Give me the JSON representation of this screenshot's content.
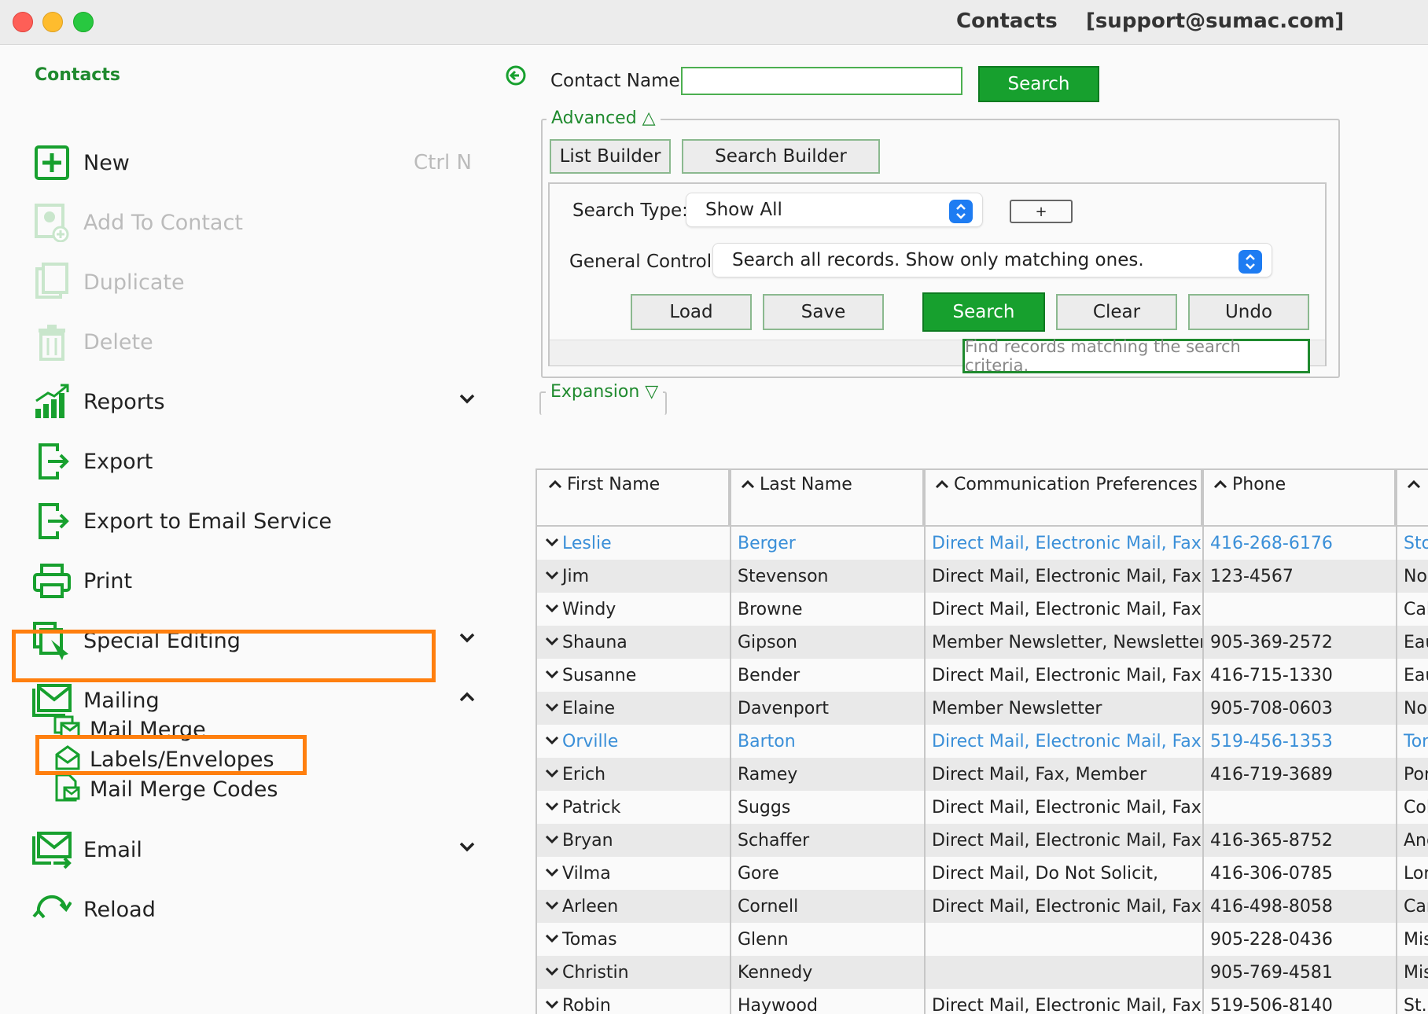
{
  "window": {
    "title": "Contacts    [support@sumac.com]"
  },
  "sidebar": {
    "title": "Contacts",
    "items": [
      {
        "label": "New",
        "shortcut": "Ctrl N",
        "icon": "plus-box-icon",
        "disabled": false
      },
      {
        "label": "Add To Contact",
        "icon": "add-contact-icon",
        "disabled": true
      },
      {
        "label": "Duplicate",
        "icon": "duplicate-icon",
        "disabled": true
      },
      {
        "label": "Delete",
        "icon": "trash-icon",
        "disabled": true
      },
      {
        "label": "Reports",
        "icon": "bar-chart-icon",
        "expandable": true
      },
      {
        "label": "Export",
        "icon": "export-icon"
      },
      {
        "label": "Export to Email Service",
        "icon": "export-icon"
      },
      {
        "label": "Print",
        "icon": "printer-icon"
      },
      {
        "label": "Special Editing",
        "icon": "special-editing-icon",
        "expandable": true
      },
      {
        "label": "Mailing",
        "icon": "mail-icon",
        "expanded": true
      },
      {
        "label": "Email",
        "icon": "email-send-icon",
        "expandable": true
      },
      {
        "label": "Reload",
        "icon": "reload-icon"
      }
    ],
    "mailing_sub": [
      {
        "label": "Mail Merge",
        "icon": "mail-merge-icon"
      },
      {
        "label": "Labels/Envelopes",
        "icon": "envelope-icon"
      },
      {
        "label": "Mail Merge Codes",
        "icon": "mail-merge-codes-icon"
      }
    ]
  },
  "search": {
    "contact_name_label": "Contact Name",
    "contact_name_value": "",
    "search_button": "Search"
  },
  "advanced": {
    "legend": "Advanced △",
    "list_builder": "List Builder",
    "search_builder": "Search Builder",
    "search_type_label": "Search Type:",
    "search_type_value": "Show All",
    "plus_button": "+",
    "general_control_label": "General Control:",
    "general_control_value": "Search all records. Show only matching ones.",
    "load": "Load",
    "save": "Save",
    "search": "Search",
    "clear": "Clear",
    "undo": "Undo",
    "tooltip": "Find records matching the search criteria."
  },
  "expansion": {
    "legend": "Expansion ▽"
  },
  "table": {
    "columns": [
      "First Name",
      "Last Name",
      "Communication Preferences",
      "Phone",
      ""
    ],
    "rows": [
      {
        "first": "Leslie",
        "last": "Berger",
        "comm": "Direct Mail, Electronic Mail, Fax,",
        "phone": "416-268-6176",
        "extra": "Sto",
        "link": true
      },
      {
        "first": "Jim",
        "last": "Stevenson",
        "comm": "Direct Mail, Electronic Mail, Fax,",
        "phone": "123-4567",
        "extra": "Nor"
      },
      {
        "first": "Windy",
        "last": "Browne",
        "comm": "Direct Mail, Electronic Mail, Fax,",
        "phone": "",
        "extra": "Cal"
      },
      {
        "first": "Shauna",
        "last": "Gipson",
        "comm": "Member Newsletter, Newsletter",
        "phone": "905-369-2572",
        "extra": "Eau"
      },
      {
        "first": "Susanne",
        "last": "Bender",
        "comm": "Direct Mail, Electronic Mail, Fax,",
        "phone": "416-715-1330",
        "extra": "Eau"
      },
      {
        "first": "Elaine",
        "last": "Davenport",
        "comm": "Member Newsletter",
        "phone": "905-708-0603",
        "extra": "Nor"
      },
      {
        "first": "Orville",
        "last": "Barton",
        "comm": "Direct Mail, Electronic Mail, Fax,",
        "phone": "519-456-1353",
        "extra": "Tor",
        "link": true
      },
      {
        "first": "Erich",
        "last": "Ramey",
        "comm": "Direct Mail, Fax, Member",
        "phone": "416-719-3689",
        "extra": "Por"
      },
      {
        "first": "Patrick",
        "last": "Suggs",
        "comm": "Direct Mail, Electronic Mail, Fax,",
        "phone": "",
        "extra": "Col"
      },
      {
        "first": "Bryan",
        "last": "Schaffer",
        "comm": "Direct Mail, Electronic Mail, Fax,",
        "phone": "416-365-8752",
        "extra": "And"
      },
      {
        "first": "Vilma",
        "last": "Gore",
        "comm": "Direct Mail, Do Not Solicit,",
        "phone": "416-306-0785",
        "extra": "Lon"
      },
      {
        "first": "Arleen",
        "last": "Cornell",
        "comm": "Direct Mail, Electronic Mail, Fax,",
        "phone": "416-498-8058",
        "extra": "Car"
      },
      {
        "first": "Tomas",
        "last": "Glenn",
        "comm": "",
        "phone": "905-228-0436",
        "extra": "Mis"
      },
      {
        "first": "Christin",
        "last": "Kennedy",
        "comm": "",
        "phone": "905-769-4581",
        "extra": "Mis"
      },
      {
        "first": "Robin",
        "last": "Haywood",
        "comm": "Direct Mail, Electronic Mail, Fax,",
        "phone": "519-506-8140",
        "extra": "St. ("
      }
    ]
  },
  "colors": {
    "green": "#17a02e",
    "link": "#3a8fd8",
    "highlight": "#ff7f0e"
  }
}
